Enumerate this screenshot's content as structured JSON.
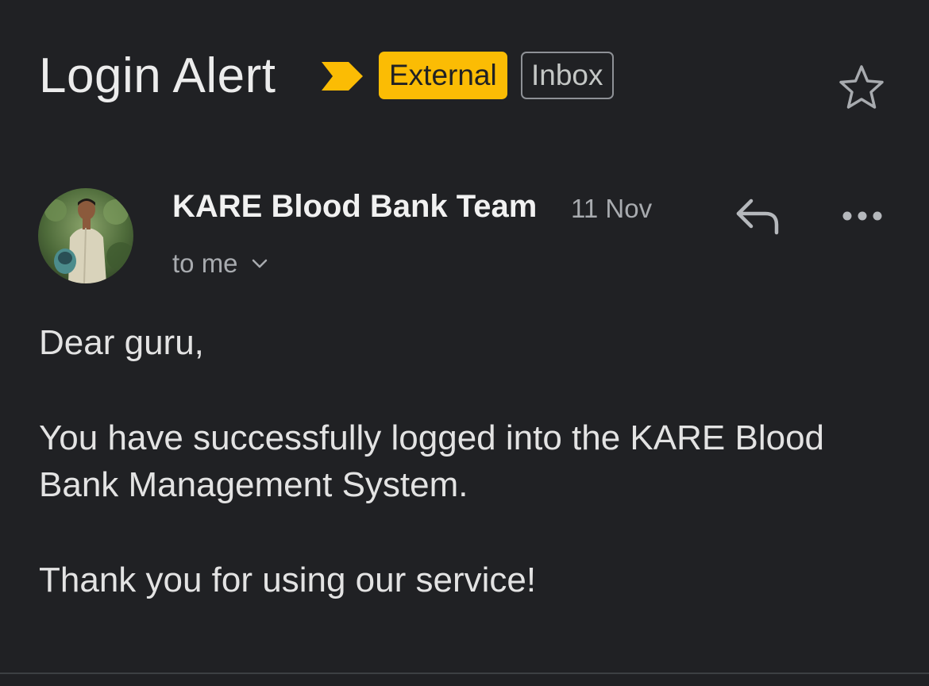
{
  "email": {
    "subject": "Login Alert",
    "labels": {
      "external": "External",
      "inbox": "Inbox"
    },
    "sender_name": "KARE Blood Bank Team",
    "date": "11 Nov",
    "recipient": "to me",
    "body": {
      "greeting": "Dear guru,",
      "main": "You have successfully logged into the KARE Blood Bank Management System.",
      "closing": "Thank you for using our service!"
    }
  },
  "colors": {
    "background": "#202124",
    "external_tag": "#fbbc04",
    "importance_marker": "#fbbc04",
    "secondary_text": "#a8abaf"
  },
  "icons": {
    "importance": "importance-marker-icon",
    "star": "star-icon",
    "reply": "reply-icon",
    "more": "more-options-icon",
    "expand": "chevron-down-icon",
    "avatar": "sender-avatar-photo"
  }
}
